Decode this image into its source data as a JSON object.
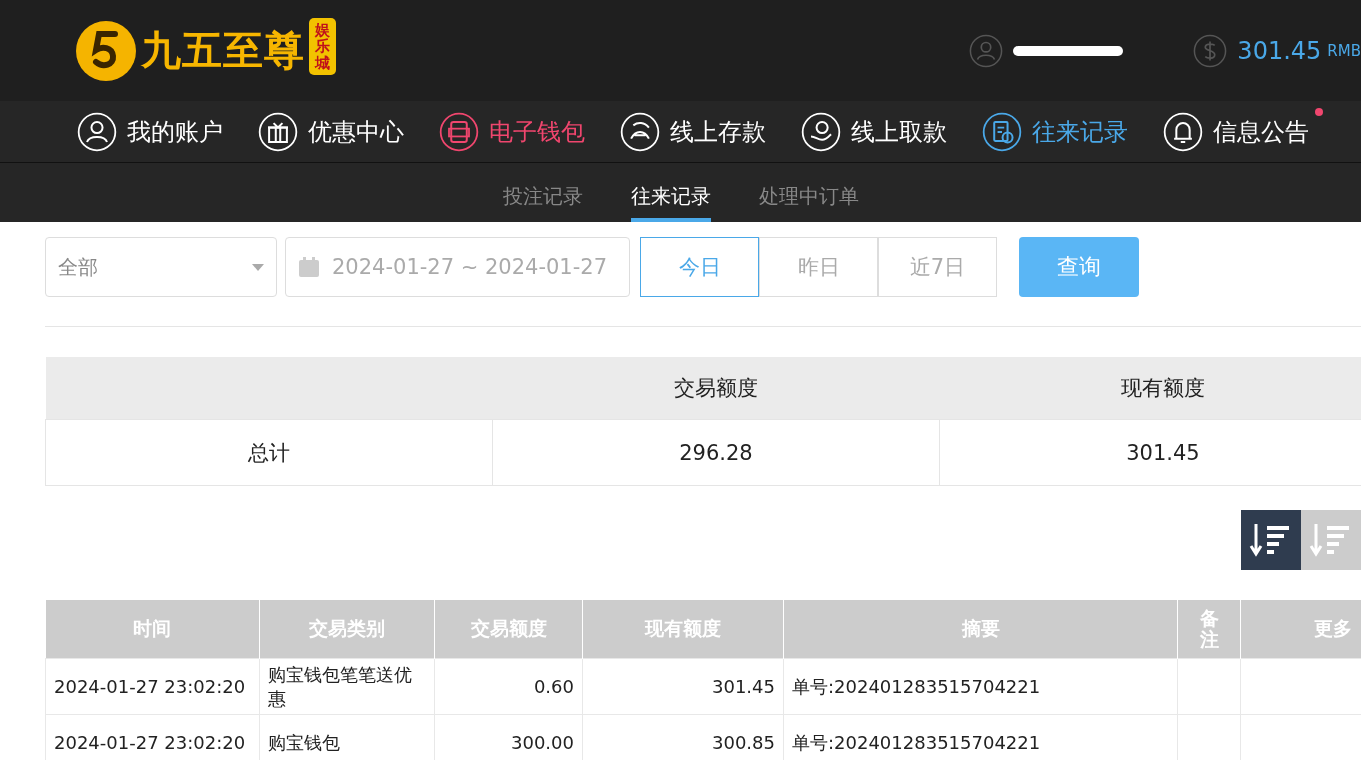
{
  "header": {
    "logo_title": "九五至尊",
    "logo_badge": "娱乐城",
    "balance": "301.45",
    "currency": "RMB"
  },
  "nav": [
    {
      "label": "我的账户",
      "color": "#ffffff",
      "badge": false
    },
    {
      "label": "优惠中心",
      "color": "#ffffff",
      "badge": false
    },
    {
      "label": "电子钱包",
      "color": "#f0466e",
      "badge": false
    },
    {
      "label": "线上存款",
      "color": "#ffffff",
      "badge": false
    },
    {
      "label": "线上取款",
      "color": "#ffffff",
      "badge": false
    },
    {
      "label": "往来记录",
      "color": "#4aa8e8",
      "badge": false
    },
    {
      "label": "信息公告",
      "color": "#ffffff",
      "badge": true
    }
  ],
  "subtabs": [
    {
      "label": "投注记录",
      "selected": false
    },
    {
      "label": "往来记录",
      "selected": true
    },
    {
      "label": "处理中订单",
      "selected": false
    }
  ],
  "filter": {
    "type_value": "全部",
    "date_range": "2024-01-27 ~ 2024-01-27",
    "quick": [
      {
        "label": "今日",
        "selected": true
      },
      {
        "label": "昨日",
        "selected": false
      },
      {
        "label": "近7日",
        "selected": false
      }
    ],
    "query_button": "查询"
  },
  "summary": {
    "columns": [
      "交易额度",
      "现有额度"
    ],
    "row_label": "总计",
    "values": [
      "296.28",
      "301.45"
    ]
  },
  "sort_buttons": [
    {
      "selected": true
    },
    {
      "selected": false
    }
  ],
  "table": {
    "columns": [
      "时间",
      "交易类别",
      "交易额度",
      "现有额度",
      "摘要",
      "备注",
      "更多"
    ],
    "rows": [
      [
        "2024-01-27 23:02:20",
        "购宝钱包笔笔送优惠",
        "0.60",
        "301.45",
        "单号:202401283515704221",
        "",
        ""
      ],
      [
        "2024-01-27 23:02:20",
        "购宝钱包",
        "300.00",
        "300.85",
        "单号:202401283515704221",
        "",
        ""
      ]
    ]
  }
}
